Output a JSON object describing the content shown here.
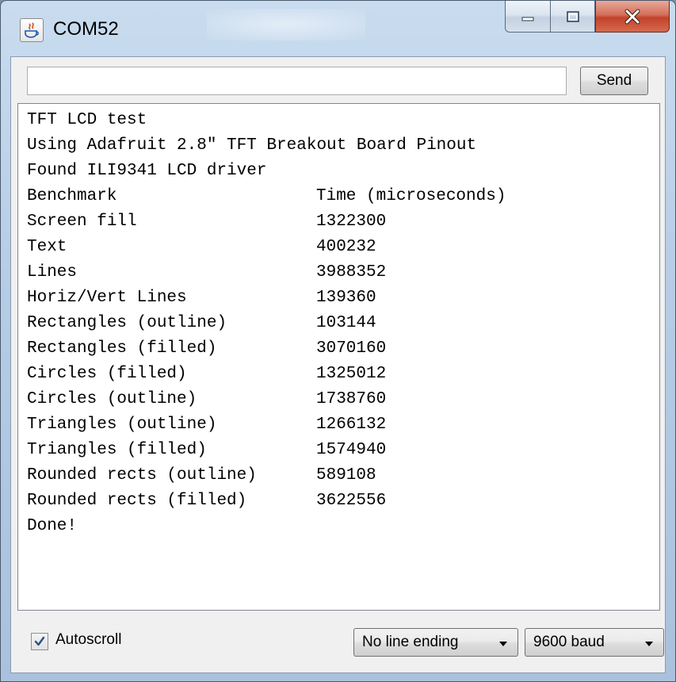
{
  "window": {
    "title": "COM52"
  },
  "send_bar": {
    "input_value": "",
    "send_label": "Send"
  },
  "output": {
    "lines": [
      {
        "left": "TFT LCD test",
        "right": ""
      },
      {
        "left": "Using Adafruit 2.8\" TFT Breakout Board Pinout",
        "right": ""
      },
      {
        "left": "Found ILI9341 LCD driver",
        "right": ""
      },
      {
        "left": "Benchmark",
        "right": "Time (microseconds)"
      },
      {
        "left": "Screen fill",
        "right": "1322300"
      },
      {
        "left": "Text",
        "right": "400232"
      },
      {
        "left": "Lines",
        "right": "3988352"
      },
      {
        "left": "Horiz/Vert Lines",
        "right": "139360"
      },
      {
        "left": "Rectangles (outline)",
        "right": "103144"
      },
      {
        "left": "Rectangles (filled)",
        "right": "3070160"
      },
      {
        "left": "Circles (filled)",
        "right": "1325012"
      },
      {
        "left": "Circles (outline)",
        "right": "1738760"
      },
      {
        "left": "Triangles (outline)",
        "right": "1266132"
      },
      {
        "left": "Triangles (filled)",
        "right": "1574940"
      },
      {
        "left": "Rounded rects (outline)",
        "right": "589108"
      },
      {
        "left": "Rounded rects (filled)",
        "right": "3622556"
      },
      {
        "left": "Done!",
        "right": ""
      }
    ]
  },
  "footer": {
    "autoscroll_label": "Autoscroll",
    "autoscroll_checked": true,
    "line_ending_value": "No line ending",
    "baud_value": "9600 baud"
  },
  "icons": {
    "app": "java-icon",
    "minimize": "minimize-icon",
    "maximize": "maximize-icon",
    "close": "close-icon",
    "dropdown": "chevron-down-icon",
    "check": "checkmark-icon"
  },
  "colors": {
    "close_button": "#c2422a",
    "titlebar": "#b7cde6",
    "checkmark": "#2a4f8f"
  }
}
